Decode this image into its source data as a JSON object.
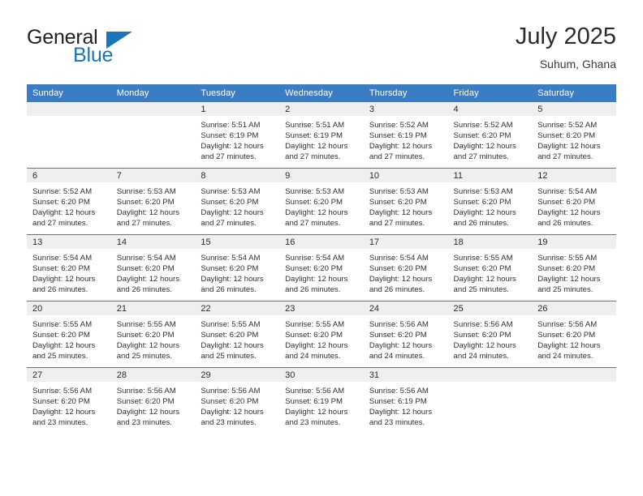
{
  "logo": {
    "word1": "General",
    "word2": "Blue",
    "icon": "triangle-icon",
    "brand_color": "#1b75bb"
  },
  "header": {
    "title": "July 2025",
    "subtitle": "Suhum, Ghana"
  },
  "theme": {
    "header_blue": "#3b7dc4",
    "daynum_band": "#efefef",
    "text": "#303030"
  },
  "calendar": {
    "weekday_headers": [
      "Sunday",
      "Monday",
      "Tuesday",
      "Wednesday",
      "Thursday",
      "Friday",
      "Saturday"
    ],
    "labels": {
      "sunrise": "Sunrise:",
      "sunset": "Sunset:",
      "daylight": "Daylight:"
    },
    "weeks": [
      [
        {
          "day": "",
          "empty": true
        },
        {
          "day": "",
          "empty": true
        },
        {
          "day": "1",
          "sunrise": "Sunrise: 5:51 AM",
          "sunset": "Sunset: 6:19 PM",
          "daylight1": "Daylight: 12 hours",
          "daylight2": "and 27 minutes."
        },
        {
          "day": "2",
          "sunrise": "Sunrise: 5:51 AM",
          "sunset": "Sunset: 6:19 PM",
          "daylight1": "Daylight: 12 hours",
          "daylight2": "and 27 minutes."
        },
        {
          "day": "3",
          "sunrise": "Sunrise: 5:52 AM",
          "sunset": "Sunset: 6:19 PM",
          "daylight1": "Daylight: 12 hours",
          "daylight2": "and 27 minutes."
        },
        {
          "day": "4",
          "sunrise": "Sunrise: 5:52 AM",
          "sunset": "Sunset: 6:20 PM",
          "daylight1": "Daylight: 12 hours",
          "daylight2": "and 27 minutes."
        },
        {
          "day": "5",
          "sunrise": "Sunrise: 5:52 AM",
          "sunset": "Sunset: 6:20 PM",
          "daylight1": "Daylight: 12 hours",
          "daylight2": "and 27 minutes."
        }
      ],
      [
        {
          "day": "6",
          "sunrise": "Sunrise: 5:52 AM",
          "sunset": "Sunset: 6:20 PM",
          "daylight1": "Daylight: 12 hours",
          "daylight2": "and 27 minutes."
        },
        {
          "day": "7",
          "sunrise": "Sunrise: 5:53 AM",
          "sunset": "Sunset: 6:20 PM",
          "daylight1": "Daylight: 12 hours",
          "daylight2": "and 27 minutes."
        },
        {
          "day": "8",
          "sunrise": "Sunrise: 5:53 AM",
          "sunset": "Sunset: 6:20 PM",
          "daylight1": "Daylight: 12 hours",
          "daylight2": "and 27 minutes."
        },
        {
          "day": "9",
          "sunrise": "Sunrise: 5:53 AM",
          "sunset": "Sunset: 6:20 PM",
          "daylight1": "Daylight: 12 hours",
          "daylight2": "and 27 minutes."
        },
        {
          "day": "10",
          "sunrise": "Sunrise: 5:53 AM",
          "sunset": "Sunset: 6:20 PM",
          "daylight1": "Daylight: 12 hours",
          "daylight2": "and 27 minutes."
        },
        {
          "day": "11",
          "sunrise": "Sunrise: 5:53 AM",
          "sunset": "Sunset: 6:20 PM",
          "daylight1": "Daylight: 12 hours",
          "daylight2": "and 26 minutes."
        },
        {
          "day": "12",
          "sunrise": "Sunrise: 5:54 AM",
          "sunset": "Sunset: 6:20 PM",
          "daylight1": "Daylight: 12 hours",
          "daylight2": "and 26 minutes."
        }
      ],
      [
        {
          "day": "13",
          "sunrise": "Sunrise: 5:54 AM",
          "sunset": "Sunset: 6:20 PM",
          "daylight1": "Daylight: 12 hours",
          "daylight2": "and 26 minutes."
        },
        {
          "day": "14",
          "sunrise": "Sunrise: 5:54 AM",
          "sunset": "Sunset: 6:20 PM",
          "daylight1": "Daylight: 12 hours",
          "daylight2": "and 26 minutes."
        },
        {
          "day": "15",
          "sunrise": "Sunrise: 5:54 AM",
          "sunset": "Sunset: 6:20 PM",
          "daylight1": "Daylight: 12 hours",
          "daylight2": "and 26 minutes."
        },
        {
          "day": "16",
          "sunrise": "Sunrise: 5:54 AM",
          "sunset": "Sunset: 6:20 PM",
          "daylight1": "Daylight: 12 hours",
          "daylight2": "and 26 minutes."
        },
        {
          "day": "17",
          "sunrise": "Sunrise: 5:54 AM",
          "sunset": "Sunset: 6:20 PM",
          "daylight1": "Daylight: 12 hours",
          "daylight2": "and 26 minutes."
        },
        {
          "day": "18",
          "sunrise": "Sunrise: 5:55 AM",
          "sunset": "Sunset: 6:20 PM",
          "daylight1": "Daylight: 12 hours",
          "daylight2": "and 25 minutes."
        },
        {
          "day": "19",
          "sunrise": "Sunrise: 5:55 AM",
          "sunset": "Sunset: 6:20 PM",
          "daylight1": "Daylight: 12 hours",
          "daylight2": "and 25 minutes."
        }
      ],
      [
        {
          "day": "20",
          "sunrise": "Sunrise: 5:55 AM",
          "sunset": "Sunset: 6:20 PM",
          "daylight1": "Daylight: 12 hours",
          "daylight2": "and 25 minutes."
        },
        {
          "day": "21",
          "sunrise": "Sunrise: 5:55 AM",
          "sunset": "Sunset: 6:20 PM",
          "daylight1": "Daylight: 12 hours",
          "daylight2": "and 25 minutes."
        },
        {
          "day": "22",
          "sunrise": "Sunrise: 5:55 AM",
          "sunset": "Sunset: 6:20 PM",
          "daylight1": "Daylight: 12 hours",
          "daylight2": "and 25 minutes."
        },
        {
          "day": "23",
          "sunrise": "Sunrise: 5:55 AM",
          "sunset": "Sunset: 6:20 PM",
          "daylight1": "Daylight: 12 hours",
          "daylight2": "and 24 minutes."
        },
        {
          "day": "24",
          "sunrise": "Sunrise: 5:56 AM",
          "sunset": "Sunset: 6:20 PM",
          "daylight1": "Daylight: 12 hours",
          "daylight2": "and 24 minutes."
        },
        {
          "day": "25",
          "sunrise": "Sunrise: 5:56 AM",
          "sunset": "Sunset: 6:20 PM",
          "daylight1": "Daylight: 12 hours",
          "daylight2": "and 24 minutes."
        },
        {
          "day": "26",
          "sunrise": "Sunrise: 5:56 AM",
          "sunset": "Sunset: 6:20 PM",
          "daylight1": "Daylight: 12 hours",
          "daylight2": "and 24 minutes."
        }
      ],
      [
        {
          "day": "27",
          "sunrise": "Sunrise: 5:56 AM",
          "sunset": "Sunset: 6:20 PM",
          "daylight1": "Daylight: 12 hours",
          "daylight2": "and 23 minutes."
        },
        {
          "day": "28",
          "sunrise": "Sunrise: 5:56 AM",
          "sunset": "Sunset: 6:20 PM",
          "daylight1": "Daylight: 12 hours",
          "daylight2": "and 23 minutes."
        },
        {
          "day": "29",
          "sunrise": "Sunrise: 5:56 AM",
          "sunset": "Sunset: 6:20 PM",
          "daylight1": "Daylight: 12 hours",
          "daylight2": "and 23 minutes."
        },
        {
          "day": "30",
          "sunrise": "Sunrise: 5:56 AM",
          "sunset": "Sunset: 6:19 PM",
          "daylight1": "Daylight: 12 hours",
          "daylight2": "and 23 minutes."
        },
        {
          "day": "31",
          "sunrise": "Sunrise: 5:56 AM",
          "sunset": "Sunset: 6:19 PM",
          "daylight1": "Daylight: 12 hours",
          "daylight2": "and 23 minutes."
        },
        {
          "day": "",
          "empty": true
        },
        {
          "day": "",
          "empty": true
        }
      ]
    ]
  }
}
